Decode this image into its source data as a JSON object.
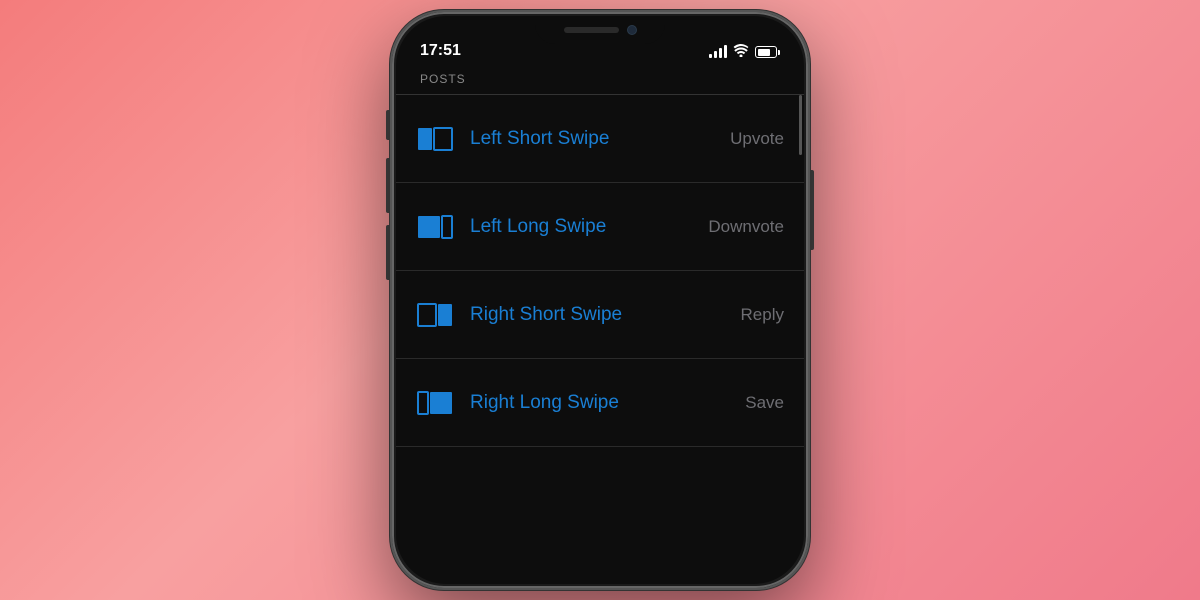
{
  "background": {
    "gradient_start": "#f47c7c",
    "gradient_end": "#f07a8a"
  },
  "phone": {
    "time": "17:51",
    "battery_percent": 75
  },
  "section": {
    "title": "POSTS"
  },
  "swipe_items": [
    {
      "id": "left-short",
      "label": "Left Short Swipe",
      "action": "Upvote",
      "icon_type": "left-short"
    },
    {
      "id": "left-long",
      "label": "Left Long Swipe",
      "action": "Downvote",
      "icon_type": "left-long"
    },
    {
      "id": "right-short",
      "label": "Right Short Swipe",
      "action": "Reply",
      "icon_type": "right-short"
    },
    {
      "id": "right-long",
      "label": "Right Long Swipe",
      "action": "Save",
      "icon_type": "right-long"
    }
  ]
}
